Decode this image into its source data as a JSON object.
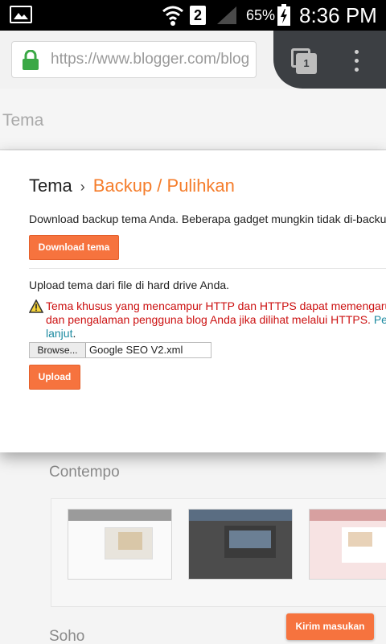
{
  "status_bar": {
    "sim_slot": "2",
    "battery_percent": "65%",
    "time": "8:36 PM"
  },
  "browser": {
    "url": "https://www.blogger.com/blog",
    "tab_count": "1"
  },
  "page": {
    "header_title": "Tema"
  },
  "modal": {
    "breadcrumb_parent": "Tema",
    "breadcrumb_separator": "›",
    "breadcrumb_current": "Backup / Pulihkan",
    "download_description": "Download backup tema Anda. Beberapa gadget mungkin tidak di-backup",
    "download_button": "Download tema",
    "upload_description": "Upload tema dari file di hard drive Anda.",
    "warning_line1": "Tema khusus yang mencampur HTTP dan HTTPS dapat memengaruhi keamanan",
    "warning_line2": "dan pengalaman pengguna blog Anda jika dilihat melalui HTTPS.",
    "warning_link_start": "Pelajari",
    "warning_link_end": "lanjut",
    "warning_period": ".",
    "browse_button": "Browse...",
    "file_name": "Google SEO V2.xml",
    "upload_button": "Upload"
  },
  "background": {
    "section1": "Contempo",
    "section2": "Soho"
  },
  "feedback_button": "Kirim masukan",
  "colors": {
    "accent": "#f6733e",
    "breadcrumb_current": "#f57d2b",
    "warning": "#cc1111",
    "link": "#1b8aa0"
  }
}
